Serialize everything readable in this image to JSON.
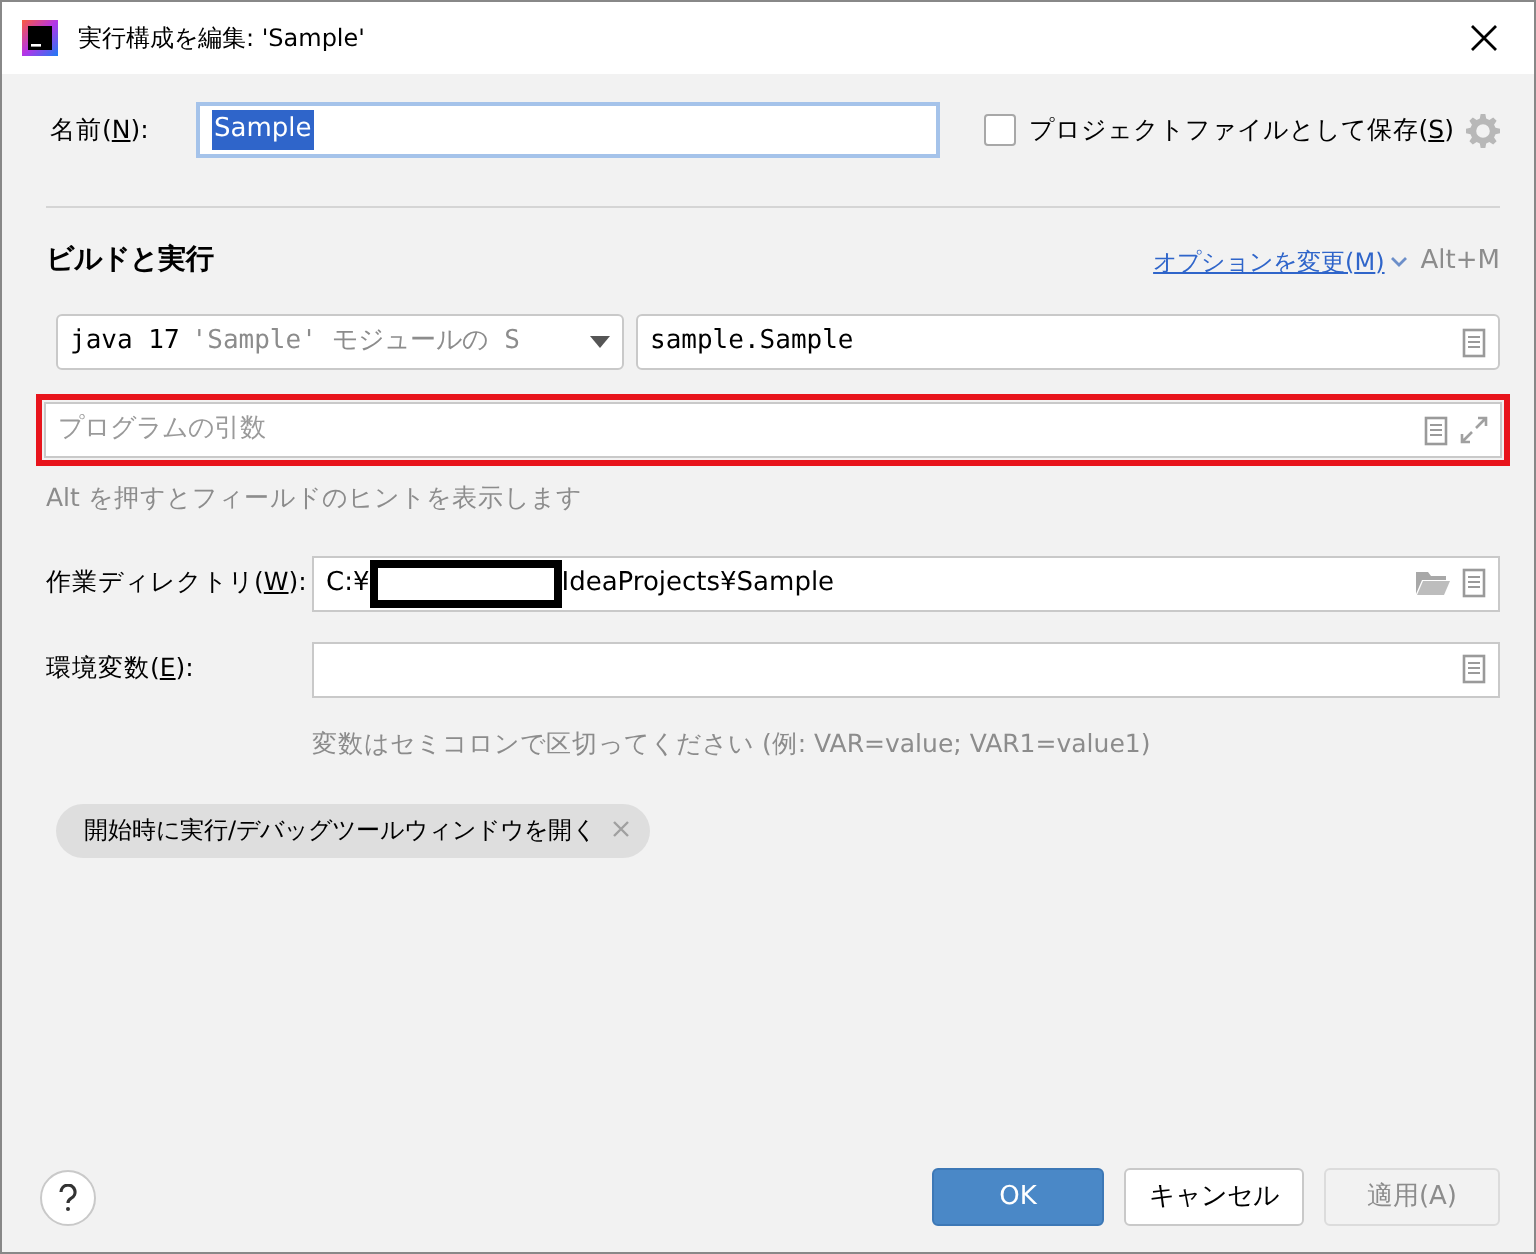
{
  "window": {
    "title": "実行構成を編集: 'Sample'"
  },
  "name_field": {
    "label_before": "名前(",
    "mnemonic": "N",
    "label_after": "):",
    "value": "Sample",
    "text_selected": true
  },
  "store_checkbox": {
    "label_before": "プロジェクトファイルとして保存(",
    "mnemonic": "S",
    "label_after": ")",
    "checked": false
  },
  "section": {
    "title": "ビルドと実行",
    "options_link_before": "オプションを変更(",
    "options_link_mnemonic": "M",
    "options_link_after": ")",
    "shortcut": "Alt+M"
  },
  "jre_select": {
    "value": "java 17",
    "detail": "'Sample' モジュールの S"
  },
  "main_class": {
    "value": "sample.Sample"
  },
  "program_args": {
    "placeholder": "プログラムの引数",
    "highlighted": true
  },
  "alt_hint": "Alt を押すとフィールドのヒントを表示します",
  "working_dir": {
    "label_before": "作業ディレクトリ(",
    "mnemonic": "W",
    "label_after": "):",
    "value_start": "C:¥",
    "redacted": true,
    "value_end": "IdeaProjects¥Sample"
  },
  "env_vars": {
    "label_before": "環境変数(",
    "mnemonic": "E",
    "label_after": "):",
    "value_hint": "変数はセミコロンで区切ってください (例: VAR=value; VAR1=value1)"
  },
  "chips": [
    {
      "label": "開始時に実行/デバッグツールウィンドウを開く"
    }
  ],
  "buttons": [
    {
      "label": "OK",
      "kind": "primary",
      "disabled": false
    },
    {
      "label": "キャンセル",
      "kind": "secondary",
      "disabled": false
    },
    {
      "label": "適用(A)",
      "kind": "secondary",
      "disabled": true
    }
  ]
}
